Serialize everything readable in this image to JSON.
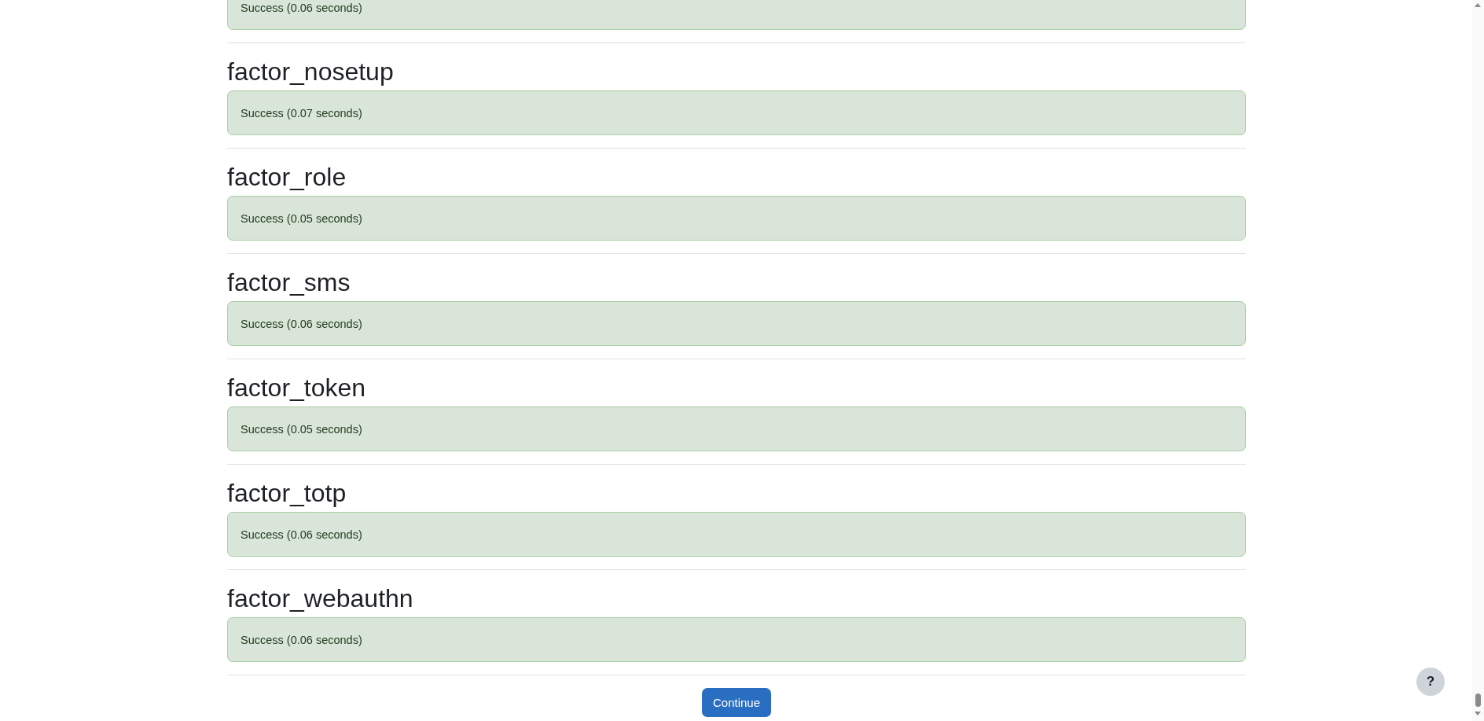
{
  "results": [
    {
      "kind": "success",
      "message": "Success (0.06 seconds)"
    },
    {
      "kind": "success",
      "title": "factor_nosetup",
      "message": "Success (0.07 seconds)"
    },
    {
      "kind": "success",
      "title": "factor_role",
      "message": "Success (0.05 seconds)"
    },
    {
      "kind": "success",
      "title": "factor_sms",
      "message": "Success (0.06 seconds)"
    },
    {
      "kind": "success",
      "title": "factor_token",
      "message": "Success (0.05 seconds)"
    },
    {
      "kind": "success",
      "title": "factor_totp",
      "message": "Success (0.06 seconds)"
    },
    {
      "kind": "success",
      "title": "factor_webauthn",
      "message": "Success (0.06 seconds)"
    }
  ],
  "continue_button": "Continue",
  "help_button": "?"
}
